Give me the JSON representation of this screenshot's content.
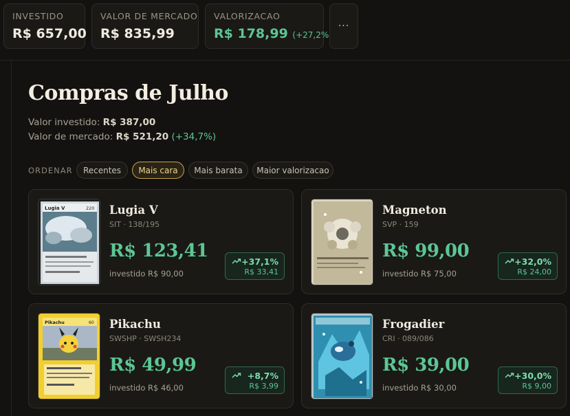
{
  "stats": [
    {
      "label": "INVESTIDO",
      "value": "R$ 657,00"
    },
    {
      "label": "VALOR DE MERCADO",
      "value": "R$ 835,99"
    },
    {
      "label": "VALORIZACAO",
      "value": "R$ 178,99",
      "pct": "(+27,2%)"
    }
  ],
  "more_label": "···",
  "page": {
    "title": "Compras de Julho",
    "invested_label": "Valor investido:",
    "invested_value": "R$ 387,00",
    "market_label": "Valor de mercado:",
    "market_value": "R$ 521,20",
    "market_pct": "(+34,7%)"
  },
  "sort": {
    "label": "ORDENAR",
    "options": [
      "Recentes",
      "Mais cara",
      "Mais barata",
      "Maior valorizacao"
    ],
    "active": "Mais cara"
  },
  "cards": [
    {
      "name": "Lugia V",
      "set": "SIT · 138/195",
      "price": "R$ 123,41",
      "invested": "investido R$ 90,00",
      "pct": "+37,1%",
      "gain": "R$ 33,41",
      "art": {
        "label": "Lugia V",
        "hp": "220"
      }
    },
    {
      "name": "Magneton",
      "set": "SVP · 159",
      "price": "R$ 99,00",
      "invested": "investido R$ 75,00",
      "pct": "+32,0%",
      "gain": "R$ 24,00",
      "art": {
        "label": "",
        "hp": ""
      }
    },
    {
      "name": "Pikachu",
      "set": "SWSHP · SWSH234",
      "price": "R$ 49,99",
      "invested": "investido R$ 46,00",
      "pct": "+8,7%",
      "gain": "R$ 3,99",
      "art": {
        "label": "Pikachu",
        "hp": "60"
      }
    },
    {
      "name": "Frogadier",
      "set": "CRI · 089/086",
      "price": "R$ 39,00",
      "invested": "investido R$ 30,00",
      "pct": "+30,0%",
      "gain": "R$ 9,00",
      "art": {
        "label": "",
        "hp": ""
      }
    }
  ],
  "colors": {
    "accent_green": "#5cc694",
    "active_chip": "#c9a24d",
    "background": "#131210"
  }
}
